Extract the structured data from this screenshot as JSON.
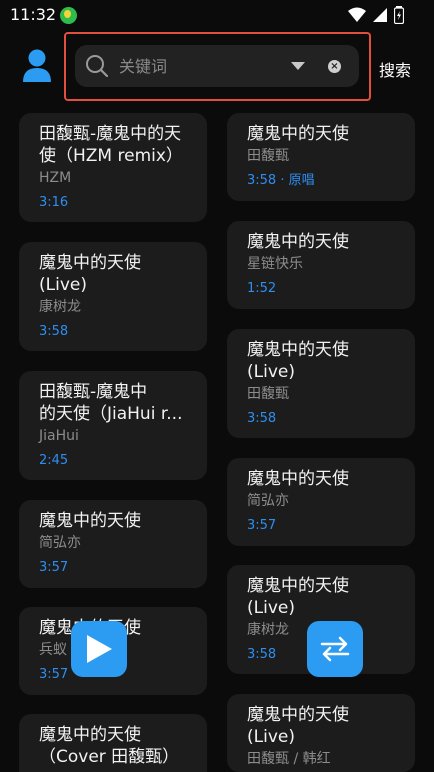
{
  "status_bar": {
    "time": "11:32"
  },
  "search": {
    "placeholder": "关键词",
    "button_label": "搜索"
  },
  "left_cards": [
    {
      "title": "田馥甄-魔鬼中的天\n使（HZM remix）",
      "artist": "HZM",
      "meta": "3:16"
    },
    {
      "title": "魔鬼中的天使\n(Live)",
      "artist": "康树龙",
      "meta": "3:58"
    },
    {
      "title": "田馥甄-魔鬼中\n的天使（JiaHui r...",
      "artist": "JiaHui",
      "meta": "2:45"
    },
    {
      "title": "魔鬼中的天使",
      "artist": "简弘亦",
      "meta": "3:57"
    },
    {
      "title": "魔鬼中的天使",
      "artist": "兵蚁",
      "meta": "3:57"
    },
    {
      "title": "魔鬼中的天使\n（Cover 田馥甄）",
      "artist": "",
      "meta": ""
    }
  ],
  "right_cards": [
    {
      "title": "魔鬼中的天使",
      "artist": "田馥甄",
      "meta": "3:58 · 原唱"
    },
    {
      "title": "魔鬼中的天使",
      "artist": "星链快乐",
      "meta": "1:52"
    },
    {
      "title": "魔鬼中的天使\n(Live)",
      "artist": "田馥甄",
      "meta": "3:58"
    },
    {
      "title": "魔鬼中的天使",
      "artist": "简弘亦",
      "meta": "3:57"
    },
    {
      "title": "魔鬼中的天使\n(Live)",
      "artist": "康树龙",
      "meta": "3:58"
    },
    {
      "title": "魔鬼中的天使\n(Live)",
      "artist": "田馥甄 / 韩红",
      "meta": ""
    }
  ],
  "colors": {
    "accent": "#2b9cf2",
    "highlight_outline": "#e24f3c",
    "card_bg": "#1c1c1c",
    "meta_text": "#2e8ef0"
  },
  "icons": {
    "avatar": "user-icon",
    "search": "search-icon",
    "dropdown": "dropdown-arrow-icon",
    "clear": "clear-icon",
    "play": "play-icon",
    "swap": "swap-arrows-icon"
  }
}
